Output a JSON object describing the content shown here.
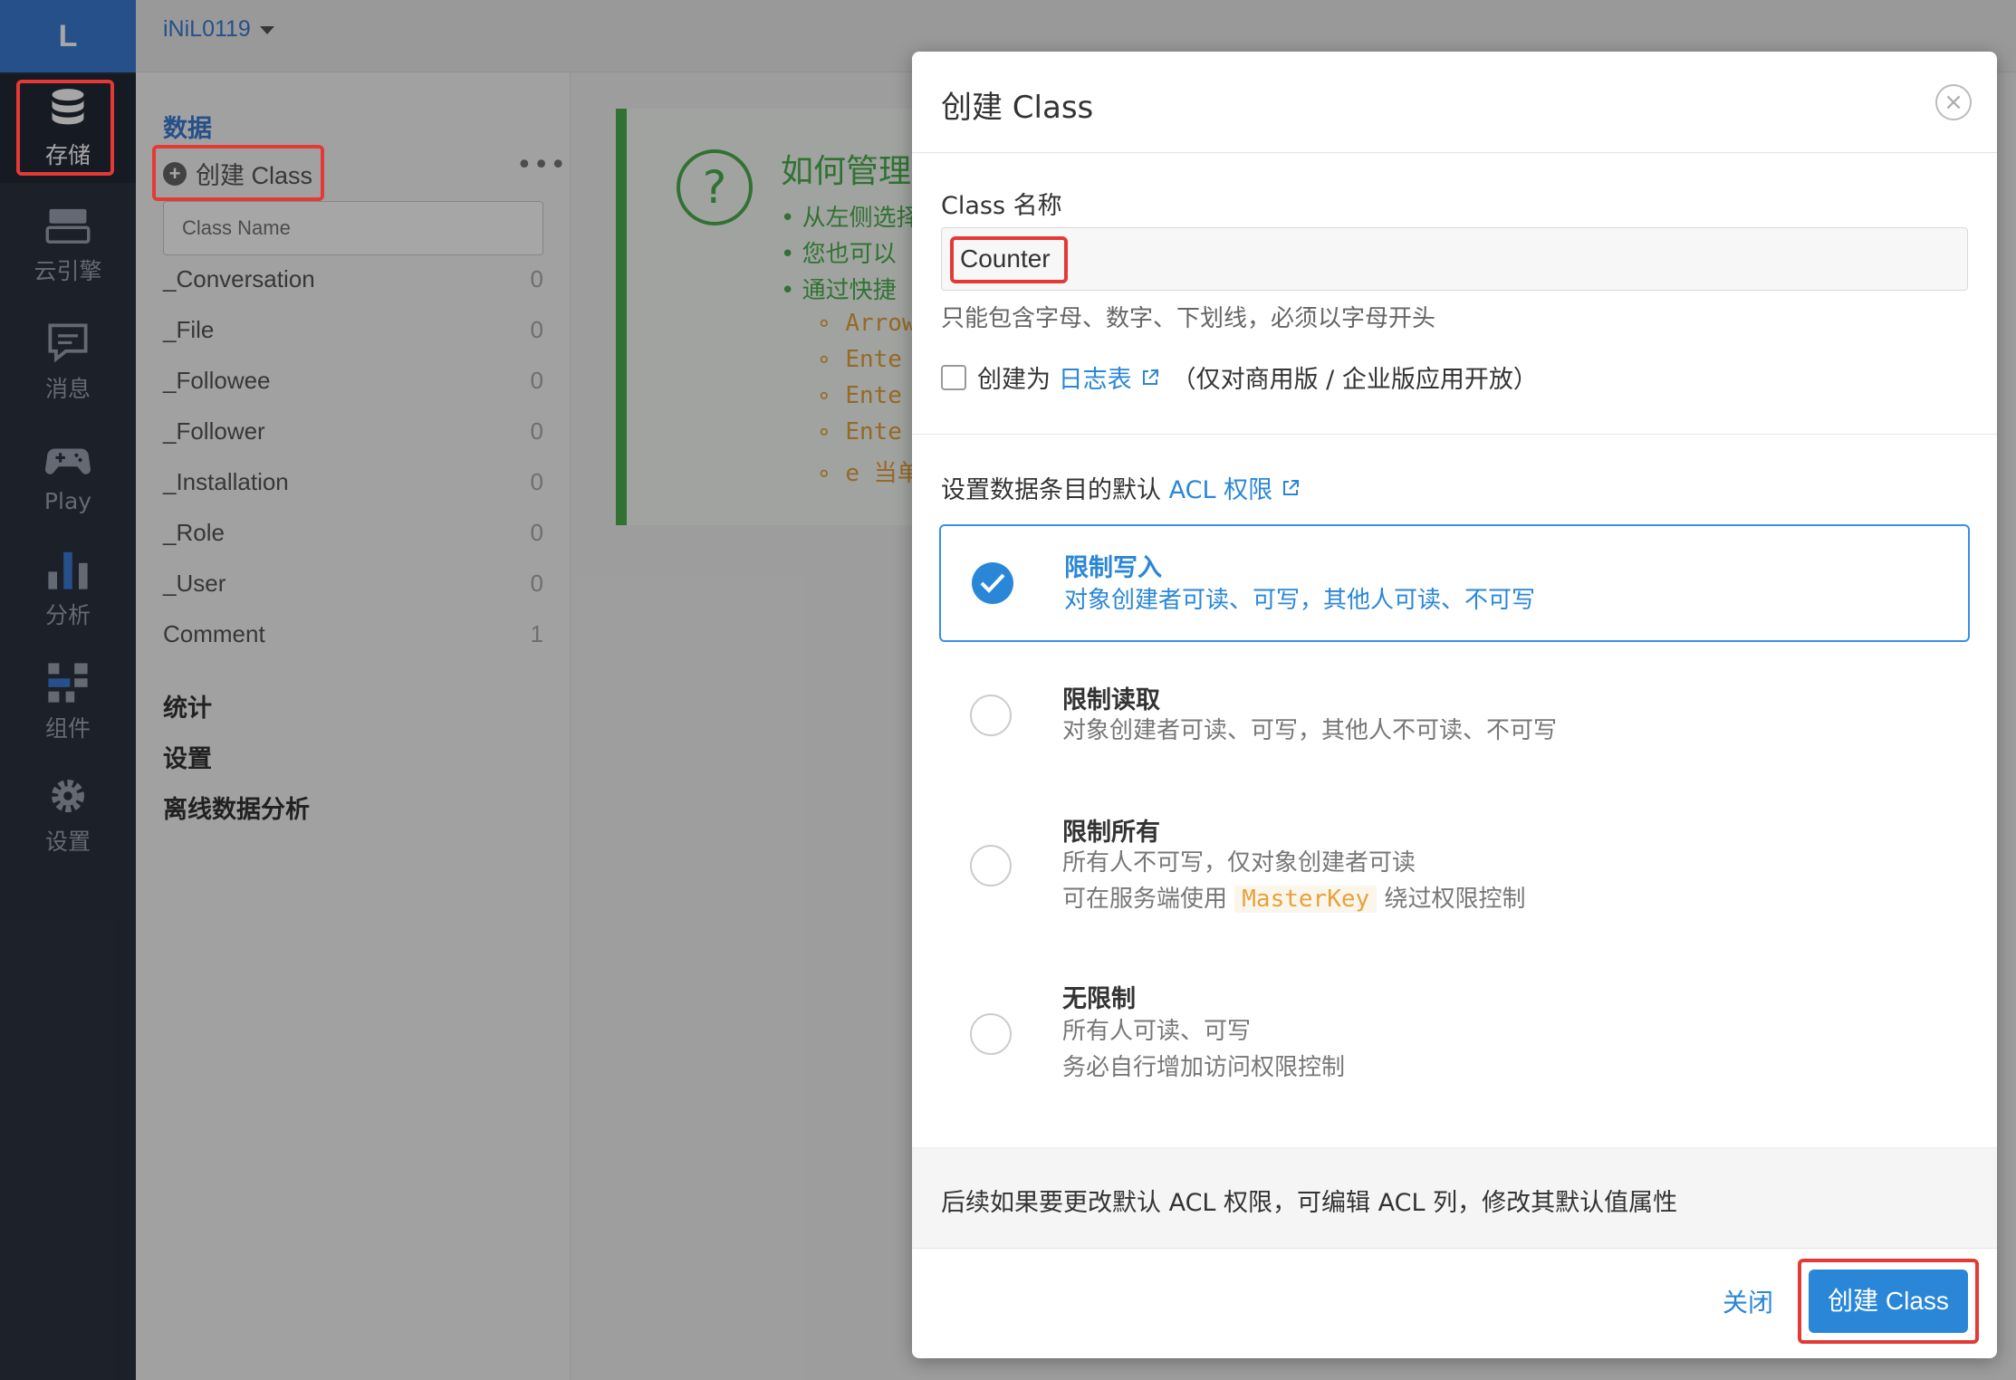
{
  "app": {
    "name": "iNiL0119",
    "logo_letter": "L"
  },
  "rail": {
    "items": [
      {
        "label": "存储",
        "icon": "database-icon"
      },
      {
        "label": "云引擎",
        "icon": "server-icon"
      },
      {
        "label": "消息",
        "icon": "message-icon"
      },
      {
        "label": "Play",
        "icon": "gamepad-icon"
      },
      {
        "label": "分析",
        "icon": "bar-chart-icon"
      },
      {
        "label": "组件",
        "icon": "components-icon"
      },
      {
        "label": "设置",
        "icon": "gear-icon"
      }
    ]
  },
  "classbar": {
    "section_title": "数据",
    "create_label": "创建 Class",
    "more": "•••",
    "search_placeholder": "Class Name",
    "classes": [
      {
        "name": "_Conversation",
        "count": "0"
      },
      {
        "name": "_File",
        "count": "0"
      },
      {
        "name": "_Followee",
        "count": "0"
      },
      {
        "name": "_Follower",
        "count": "0"
      },
      {
        "name": "_Installation",
        "count": "0"
      },
      {
        "name": "_Role",
        "count": "0"
      },
      {
        "name": "_User",
        "count": "0"
      },
      {
        "name": "Comment",
        "count": "1"
      }
    ],
    "nav": [
      "统计",
      "设置",
      "离线数据分析"
    ]
  },
  "help": {
    "title": "如何管理我",
    "items": [
      "从左侧选择",
      "您也可以",
      "通过快捷"
    ],
    "codes": [
      "Arrow",
      "Ente",
      "Ente",
      "Ente",
      "e 当单"
    ]
  },
  "modal": {
    "title": "创建 Class",
    "name_label": "Class 名称",
    "name_value": "Counter",
    "name_hint": "只能包含字母、数字、下划线，必须以字母开头",
    "log_prefix": "创建为",
    "log_link": "日志表",
    "log_suffix": "（仅对商用版 / 企业版应用开放）",
    "acl_title": "设置数据条目的默认",
    "acl_link": "ACL 权限",
    "options": [
      {
        "title": "限制写入",
        "desc": [
          "对象创建者可读、可写，其他人可读、不可写"
        ],
        "selected": true
      },
      {
        "title": "限制读取",
        "desc": [
          "对象创建者可读、可写，其他人不可读、不可写"
        ],
        "selected": false
      },
      {
        "title": "限制所有",
        "desc": [
          "所有人不可写，仅对象创建者可读"
        ],
        "desc2_prefix": "可在服务端使用",
        "desc2_code": "MasterKey",
        "desc2_suffix": "绕过权限控制",
        "selected": false
      },
      {
        "title": "无限制",
        "desc": [
          "所有人可读、可写",
          "务必自行增加访问权限控制"
        ],
        "selected": false
      }
    ],
    "note": "后续如果要更改默认 ACL 权限，可编辑 ACL 列，修改其默认值属性",
    "close_label": "关闭",
    "create_label": "创建 Class"
  },
  "colors": {
    "accent": "#2a87d8",
    "rail_bg": "#2c3240",
    "highlight": "#e53935",
    "help_green": "#4caf50"
  }
}
